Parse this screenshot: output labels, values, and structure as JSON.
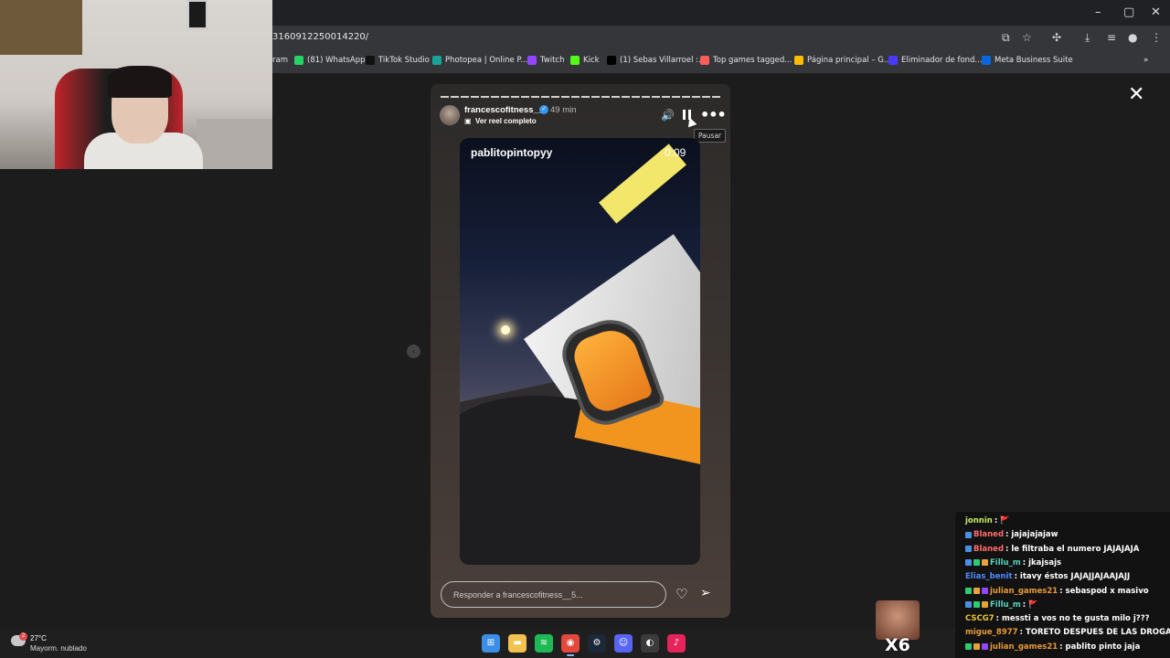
{
  "browser": {
    "url": "3160912250014220/",
    "window_controls": [
      "–",
      "▢",
      "✕"
    ],
    "bookmarks": [
      {
        "label": "ram",
        "color": "#1c1c1c"
      },
      {
        "label": "(81) WhatsApp",
        "color": "#25d366"
      },
      {
        "label": "TikTok Studio",
        "color": "#111111"
      },
      {
        "label": "Photopea | Online P...",
        "color": "#18a497"
      },
      {
        "label": "Twitch",
        "color": "#9146ff"
      },
      {
        "label": "Kick",
        "color": "#53fc18"
      },
      {
        "label": "(1) Sebas Villarroel :...",
        "color": "#000000"
      },
      {
        "label": "Top games tagged...",
        "color": "#fa5c5c"
      },
      {
        "label": "Página principal – G...",
        "color": "#fbbc04"
      },
      {
        "label": "Eliminador de fond...",
        "color": "#4a3aff"
      },
      {
        "label": "Meta Business Suite",
        "color": "#0668e1"
      }
    ]
  },
  "story": {
    "username": "francescofitness__5",
    "time_ago": "49 min",
    "reel_link": "Ver reel completo",
    "tooltip": "Pausar",
    "video_username": "pablitopintopyy",
    "video_time": "0:09",
    "reply_placeholder": "Responder a francescofitness__5...",
    "progress_segments": 28
  },
  "weather": {
    "temp": "27°C",
    "condition": "Mayorm. nublado",
    "badge": "2"
  },
  "taskbar": [
    {
      "name": "windows-start",
      "color": "#3a8ee6",
      "glyph": "⊞"
    },
    {
      "name": "file-explorer",
      "color": "#f2c14e",
      "glyph": "▬"
    },
    {
      "name": "spotify",
      "color": "#1db954",
      "glyph": "≋"
    },
    {
      "name": "chrome",
      "color": "#e2483b",
      "glyph": "◉",
      "active": true
    },
    {
      "name": "steam",
      "color": "#1b2838",
      "glyph": "⚙"
    },
    {
      "name": "discord",
      "color": "#5865f2",
      "glyph": "☺"
    },
    {
      "name": "obs",
      "color": "#3b3b3b",
      "glyph": "◐"
    },
    {
      "name": "tiktok",
      "color": "#e5245c",
      "glyph": "♪"
    }
  ],
  "chat": [
    {
      "user": "jonnin",
      "user_color": "#c8e864",
      "text": ": 🚩",
      "badges": []
    },
    {
      "user": "Blaned",
      "user_color": "#ff6b6b",
      "text": ": jajajajajaw",
      "badges": [
        "#4a90e2"
      ]
    },
    {
      "user": "Blaned",
      "user_color": "#ff6b6b",
      "text": ": le filtraba el numero JAJAJAJA",
      "badges": [
        "#4a90e2"
      ]
    },
    {
      "user": "Fillu_m",
      "user_color": "#55d6be",
      "text": ": jkajsajs",
      "badges": [
        "#4a90e2",
        "#2ecc71",
        "#e8a23a"
      ]
    },
    {
      "user": "Elias_benit",
      "user_color": "#4f8bff",
      "text": ": itavy éstos JAJAJJAJAAJAJJ",
      "badges": []
    },
    {
      "user": "julian_games21",
      "user_color": "#e89a3a",
      "text": ": sebaspod x masivo",
      "badges": [
        "#2ecc71",
        "#e8a23a",
        "#9146ff"
      ]
    },
    {
      "user": "Fillu_m",
      "user_color": "#55d6be",
      "text": ": 🚩",
      "badges": [
        "#4a90e2",
        "#2ecc71",
        "#e8a23a"
      ]
    },
    {
      "user": "CSCG7",
      "user_color": "#e8c43a",
      "text": ": messti a vos no te gusta milo j???",
      "badges": []
    },
    {
      "user": "migue_8977",
      "user_color": "#e89a3a",
      "text": ": TORETO DESPUES DE LAS DROGAS",
      "badges": []
    },
    {
      "user": "julian_games21",
      "user_color": "#e89a3a",
      "text": ": pablito pinto jaja",
      "badges": [
        "#2ecc71",
        "#e8a23a",
        "#9146ff"
      ]
    }
  ],
  "emote": {
    "multiplier": "X6"
  }
}
